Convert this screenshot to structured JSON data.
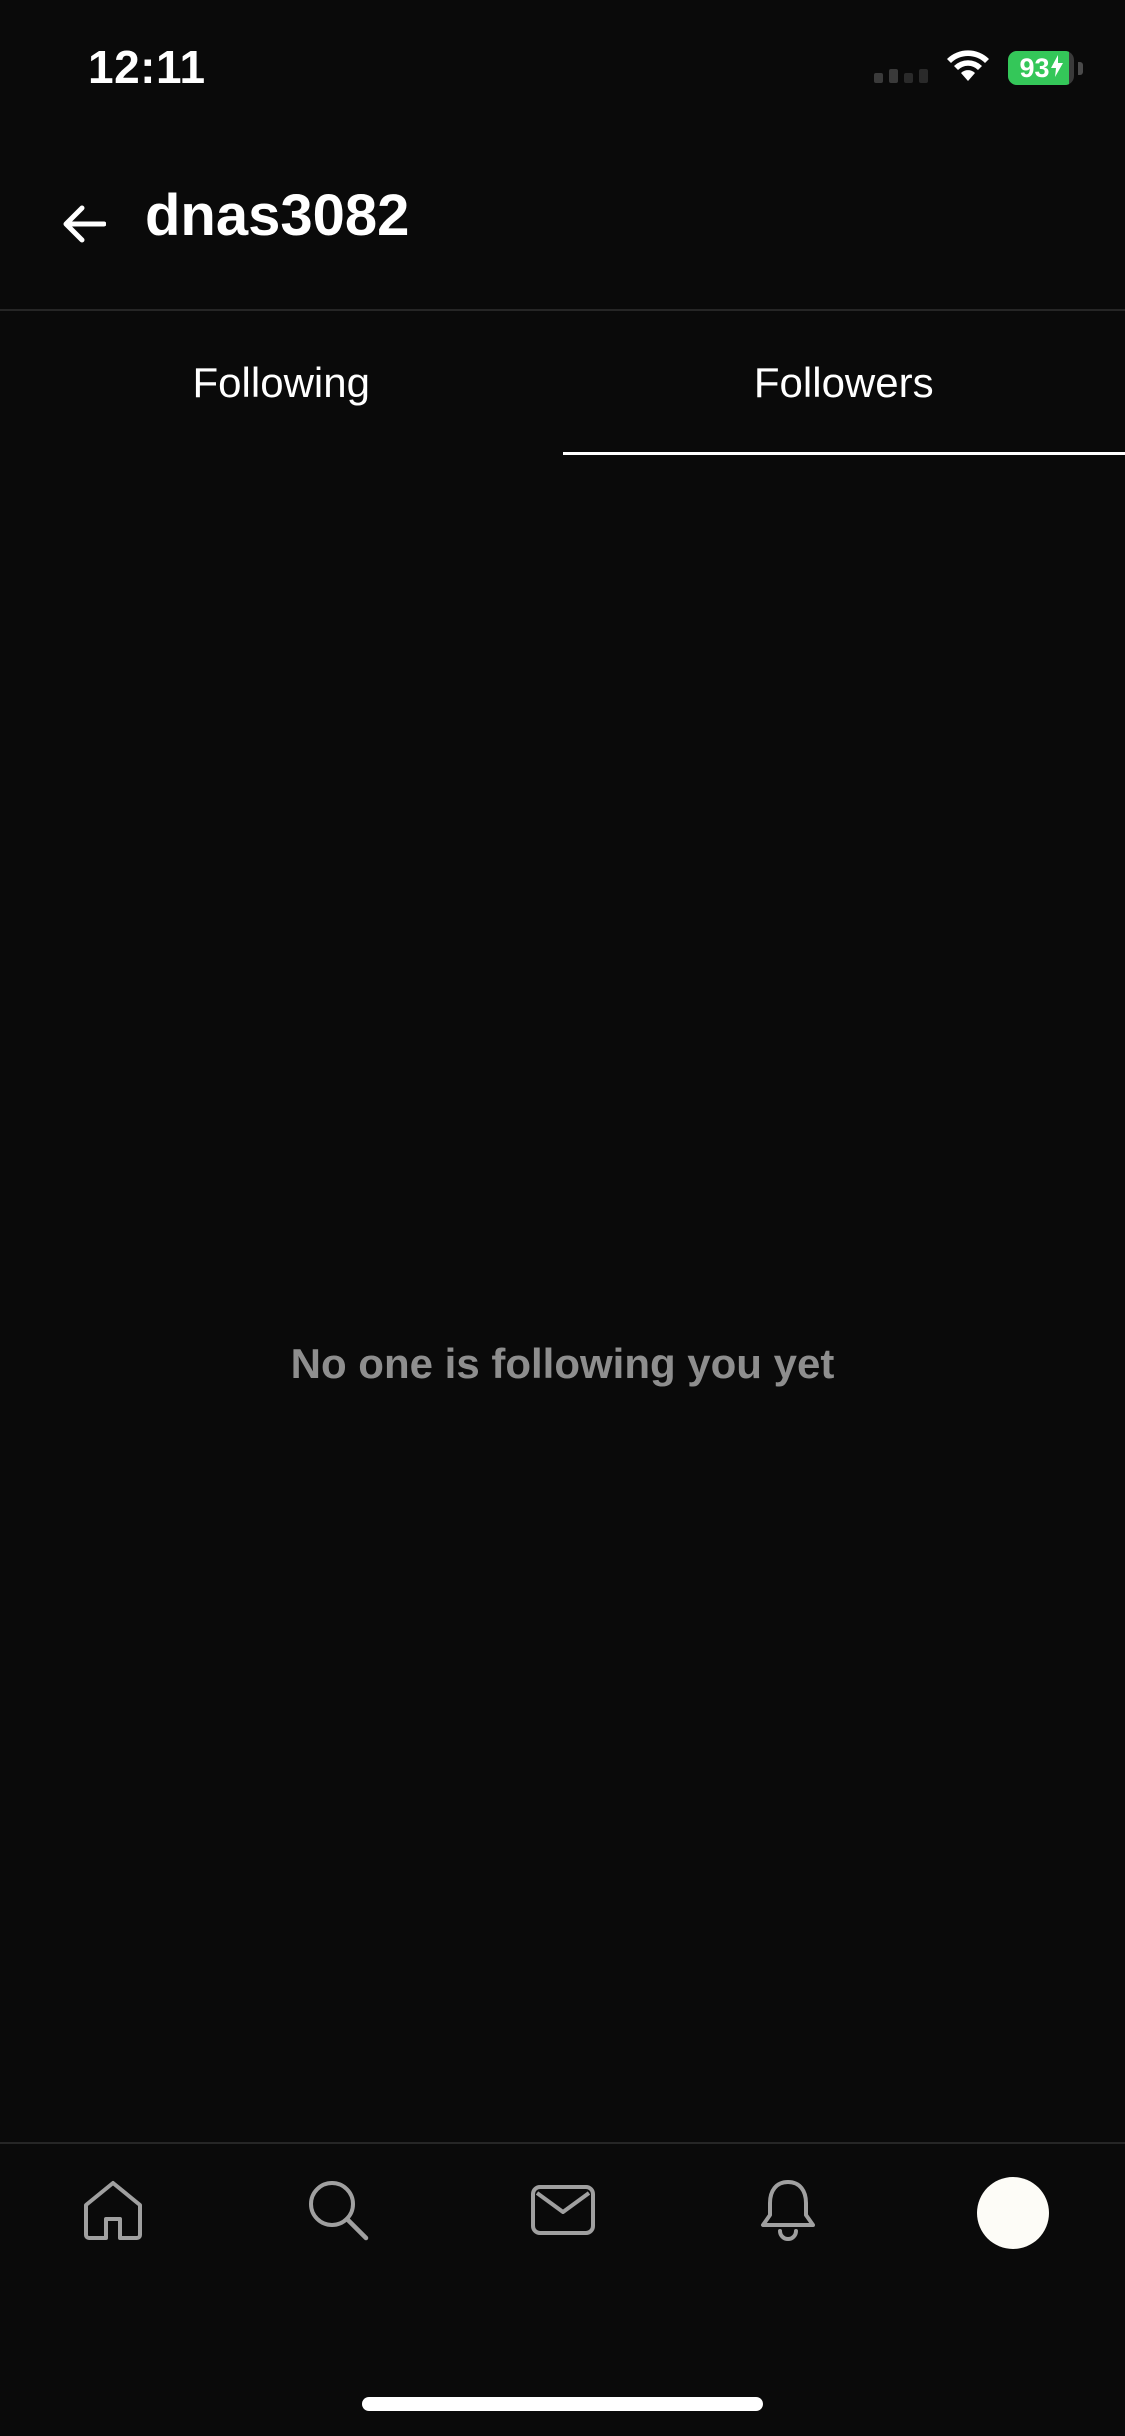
{
  "status_bar": {
    "time": "12:11",
    "battery_percent": "93",
    "battery_level": 0.93,
    "wifi_icon": "wifi-icon",
    "signal_icon": "cellular-signal-icon",
    "battery_color": "#34c759"
  },
  "header": {
    "back_icon": "arrow-left-icon",
    "title": "dnas3082"
  },
  "tabs": [
    {
      "label": "Following",
      "active": false
    },
    {
      "label": "Followers",
      "active": true
    }
  ],
  "empty_state": {
    "message": "No one is following you yet"
  },
  "bottom_nav": {
    "items": [
      {
        "icon": "home-icon"
      },
      {
        "icon": "search-icon"
      },
      {
        "icon": "mail-icon"
      },
      {
        "icon": "bell-icon"
      },
      {
        "icon": "profile-avatar"
      }
    ]
  },
  "colors": {
    "background": "#0a0a0a",
    "text_primary": "#ffffff",
    "text_muted": "#8e8e8e",
    "divider": "#262626"
  }
}
